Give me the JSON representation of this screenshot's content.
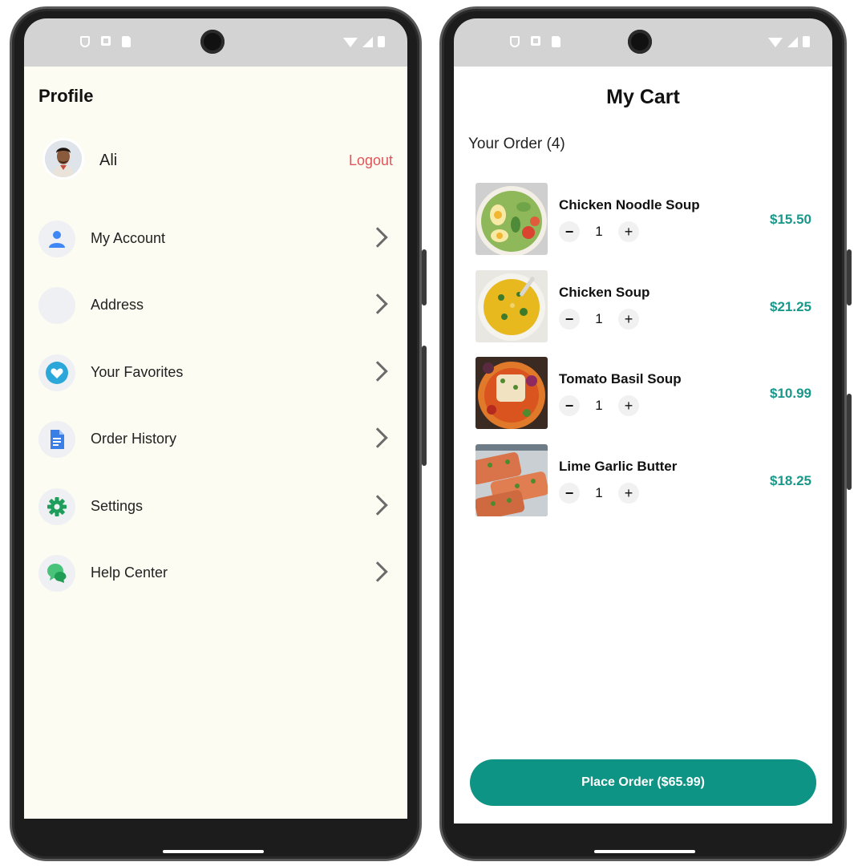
{
  "profile_screen": {
    "title": "Profile",
    "user": {
      "name": "Ali",
      "avatar": "avatar-photo"
    },
    "logout_label": "Logout",
    "menu_items": [
      {
        "label": "My Account",
        "icon": "person-icon"
      },
      {
        "label": "Address",
        "icon": "address-icon"
      },
      {
        "label": "Your Favorites",
        "icon": "heart-icon"
      },
      {
        "label": "Order History",
        "icon": "document-icon"
      },
      {
        "label": "Settings",
        "icon": "gear-icon"
      },
      {
        "label": "Help Center",
        "icon": "chat-icon"
      }
    ]
  },
  "cart_screen": {
    "title": "My Cart",
    "order_count_label": "Your Order (4)",
    "items": [
      {
        "name": "Chicken Noodle Soup",
        "quantity": "1",
        "price": "$15.50"
      },
      {
        "name": "Chicken Soup",
        "quantity": "1",
        "price": "$21.25"
      },
      {
        "name": "Tomato Basil Soup",
        "quantity": "1",
        "price": "$10.99"
      },
      {
        "name": "Lime Garlic Butter",
        "quantity": "1",
        "price": "$18.25"
      }
    ],
    "place_order_label": "Place Order ($65.99)"
  },
  "colors": {
    "accent": "#0e9484",
    "price": "#18988a",
    "logout": "#e0555a",
    "profile_background": "#fcfcf2",
    "status_bar": "#d3d3d3"
  }
}
